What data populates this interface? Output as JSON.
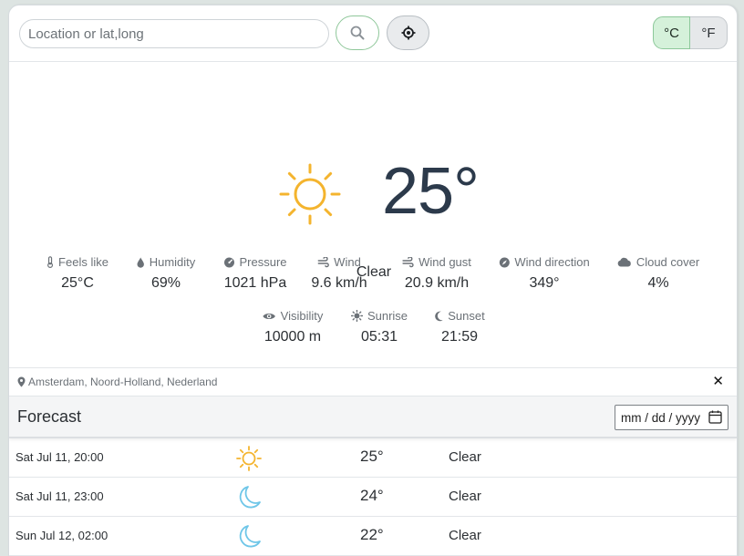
{
  "search": {
    "placeholder": "Location or lat,long"
  },
  "units": {
    "celsius": "°C",
    "fahrenheit": "°F",
    "selected": "celsius"
  },
  "colors": {
    "accent": "#8dc89a",
    "sun": "#f4b42e",
    "moon": "#6ec6e8"
  },
  "current": {
    "icon": "sun-icon",
    "temperature": "25°",
    "condition": "Clear",
    "stats": [
      {
        "label": "Feels like",
        "value": "25°C",
        "icon": "thermometer-icon"
      },
      {
        "label": "Humidity",
        "value": "69%",
        "icon": "droplet-icon"
      },
      {
        "label": "Pressure",
        "value": "1021 hPa",
        "icon": "gauge-icon"
      },
      {
        "label": "Wind",
        "value": "9.6 km/h",
        "icon": "wind-icon"
      },
      {
        "label": "Wind gust",
        "value": "20.9 km/h",
        "icon": "wind-gust-icon"
      },
      {
        "label": "Wind direction",
        "value": "349°",
        "icon": "compass-icon"
      },
      {
        "label": "Cloud cover",
        "value": "4%",
        "icon": "cloud-icon"
      },
      {
        "label": "Visibility",
        "value": "10000 m",
        "icon": "eye-icon"
      },
      {
        "label": "Sunrise",
        "value": "05:31",
        "icon": "sunrise-icon"
      },
      {
        "label": "Sunset",
        "value": "21:59",
        "icon": "moon-icon"
      }
    ]
  },
  "location": {
    "name": "Amsterdam, Noord-Holland, Nederland",
    "close": "✕"
  },
  "forecast": {
    "title": "Forecast",
    "date_placeholder": "mm / dd / yyyy",
    "rows": [
      {
        "time": "Sat Jul 11, 20:00",
        "icon": "sun-icon",
        "temp": "25°",
        "condition": "Clear"
      },
      {
        "time": "Sat Jul 11, 23:00",
        "icon": "moon-icon",
        "temp": "24°",
        "condition": "Clear"
      },
      {
        "time": "Sun Jul 12, 02:00",
        "icon": "moon-icon",
        "temp": "22°",
        "condition": "Clear"
      }
    ]
  }
}
